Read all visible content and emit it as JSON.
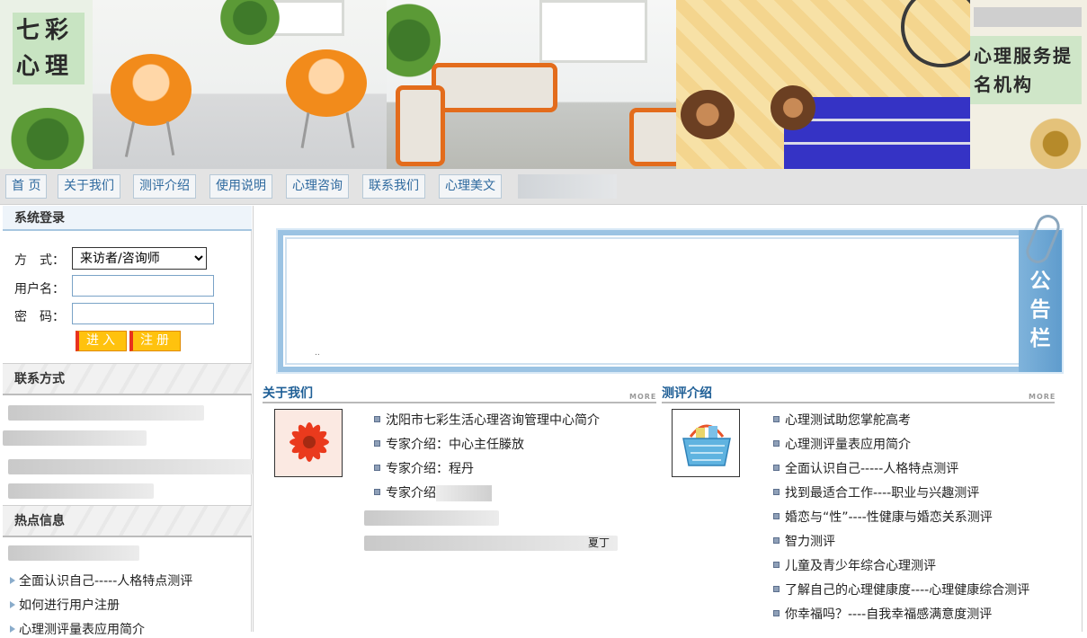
{
  "banner": {
    "logo_left": "七彩心理",
    "logo_right": "心理服务提名机构"
  },
  "nav": {
    "items": [
      "首 页",
      "关于我们",
      "测评介绍",
      "使用说明",
      "心理咨询",
      "联系我们",
      "心理美文"
    ]
  },
  "sidebar": {
    "login": {
      "heading": "系统登录",
      "mode_label": "方　式：",
      "mode_value": "来访者/咨询师",
      "username_label": "用户名：",
      "username_value": "",
      "password_label": "密　码：",
      "password_value": "",
      "enter_button": "进入",
      "register_button": "注册"
    },
    "contact": {
      "heading": "联系方式"
    },
    "hot": {
      "heading": "热点信息",
      "items": [
        "全面认识自己-----人格特点测评",
        "如何进行用户注册",
        "心理测评量表应用简介"
      ]
    }
  },
  "main": {
    "notice": {
      "tab_chars": [
        "公",
        "告",
        "栏"
      ],
      "dot": ".."
    },
    "about": {
      "title": "关于我们",
      "more": "MORE",
      "items": [
        "沈阳市七彩生活心理咨询管理中心简介",
        "专家介绍：中心主任滕放",
        "专家介绍：程丹",
        "专家介绍"
      ],
      "tail": "夏丁"
    },
    "assess": {
      "title": "测评介绍",
      "more": "MORE",
      "items": [
        "心理测试助您掌舵高考",
        "心理测评量表应用简介",
        "全面认识自己-----人格特点测评",
        "找到最适合工作----职业与兴趣测评",
        "婚恋与“性”----性健康与婚恋关系测评",
        "智力测评",
        "儿童及青少年综合心理测评",
        "了解自己的心理健康度----心理健康综合测评",
        "你幸福吗？----自我幸福感满意度测评"
      ]
    }
  },
  "colors": {
    "link": "#2f6a9f",
    "section_title": "#1f5f96",
    "button": "#ffc20e",
    "notice_border": "#9bc3e3"
  }
}
